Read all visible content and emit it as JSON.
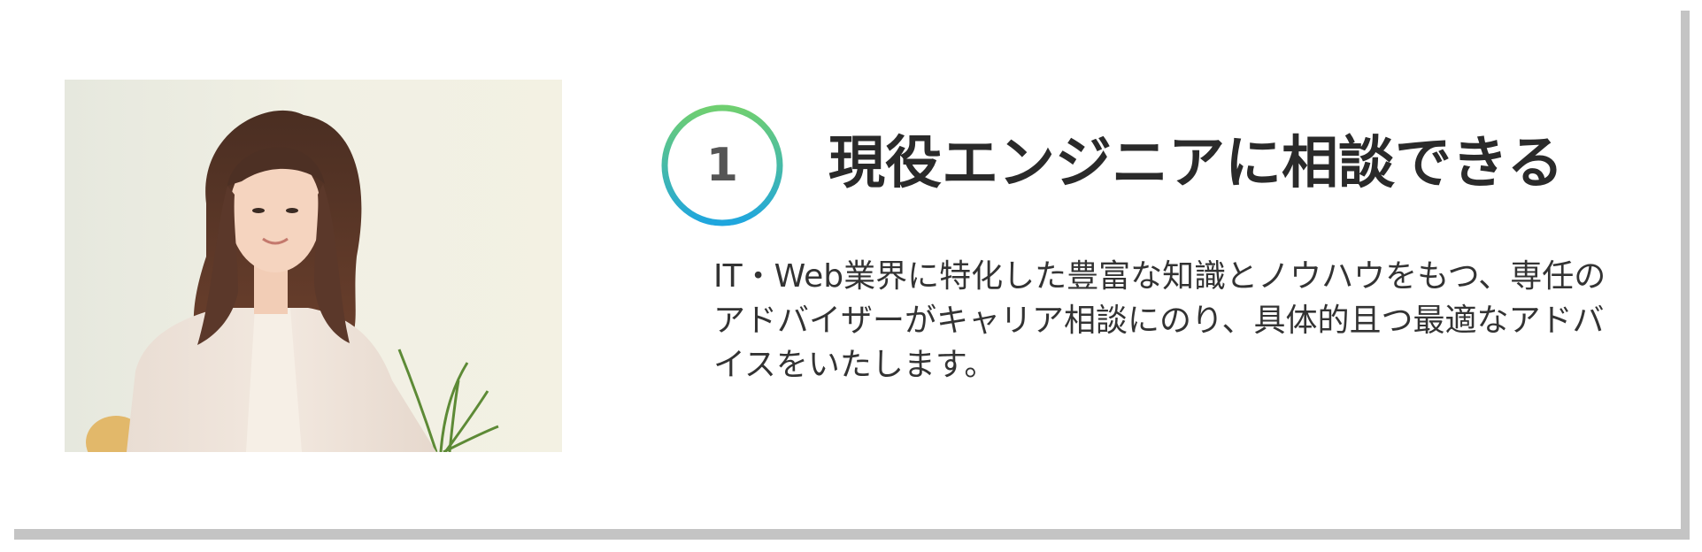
{
  "feature": {
    "number": "1",
    "title": "現役エンジニアに相談できる",
    "description": "IT・Web業界に特化した豊富な知識とノウハウをもつ、専任のアドバイザーがキャリア相談にのり、具体的且つ最適なアドバイスをいたします。"
  },
  "photo": {
    "subject": "advisor-portrait"
  },
  "colors": {
    "badge_gradient_top": "#6fcf70",
    "badge_gradient_bottom": "#1fa6de",
    "card_shadow": "#c4c4c4",
    "title_text": "#2a2a2a",
    "badge_number": "#555555"
  }
}
